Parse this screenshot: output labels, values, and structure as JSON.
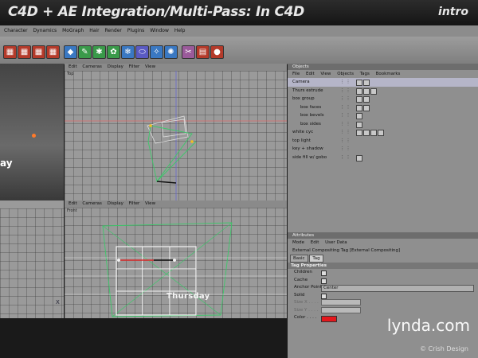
{
  "banner": {
    "title": "C4D + AE Integration/Multi-Pass: In C4D",
    "tag": "intro"
  },
  "menu": [
    "Character",
    "Dynamics",
    "MoGraph",
    "Hair",
    "Render",
    "Plugins",
    "Window",
    "Help"
  ],
  "viewports": {
    "menu": [
      "Edit",
      "Cameras",
      "Display",
      "Filter",
      "View"
    ],
    "top_label": "Top",
    "front_label": "Front",
    "scene_text": "Thursday",
    "left_text": "ay"
  },
  "objects": {
    "header": "Objects",
    "menu": [
      "File",
      "Edit",
      "View",
      "Objects",
      "Tags",
      "Bookmarks"
    ],
    "rows": [
      {
        "name": "Camera",
        "indent": 0
      },
      {
        "name": "Thurs extrude",
        "indent": 0
      },
      {
        "name": "box group",
        "indent": 0
      },
      {
        "name": "box faces",
        "indent": 1
      },
      {
        "name": "box bevels",
        "indent": 1
      },
      {
        "name": "box sides",
        "indent": 1
      },
      {
        "name": "white cyc",
        "indent": 0
      },
      {
        "name": "top light",
        "indent": 0
      },
      {
        "name": "key + shadow",
        "indent": 0
      },
      {
        "name": "side fill w/ gobo",
        "indent": 0
      }
    ]
  },
  "attributes": {
    "header": "Attributes",
    "menu": [
      "Mode",
      "Edit",
      "User Data"
    ],
    "title": "External Compositing Tag [External Compositing]",
    "tabs": [
      "Basic",
      "Tag"
    ],
    "section": "Tag Properties",
    "props": {
      "children": "Children",
      "cache": "Cache",
      "anchor": "Anchor Point",
      "anchor_value": "Center",
      "solid": "Solid",
      "sizex": "Size X . . . .",
      "sizey": "Size Y . . . .",
      "color": "Color . . . ."
    },
    "swatch_color": "#e3171c"
  },
  "watermark": "lynda.com",
  "copyright": "© Crish Design"
}
